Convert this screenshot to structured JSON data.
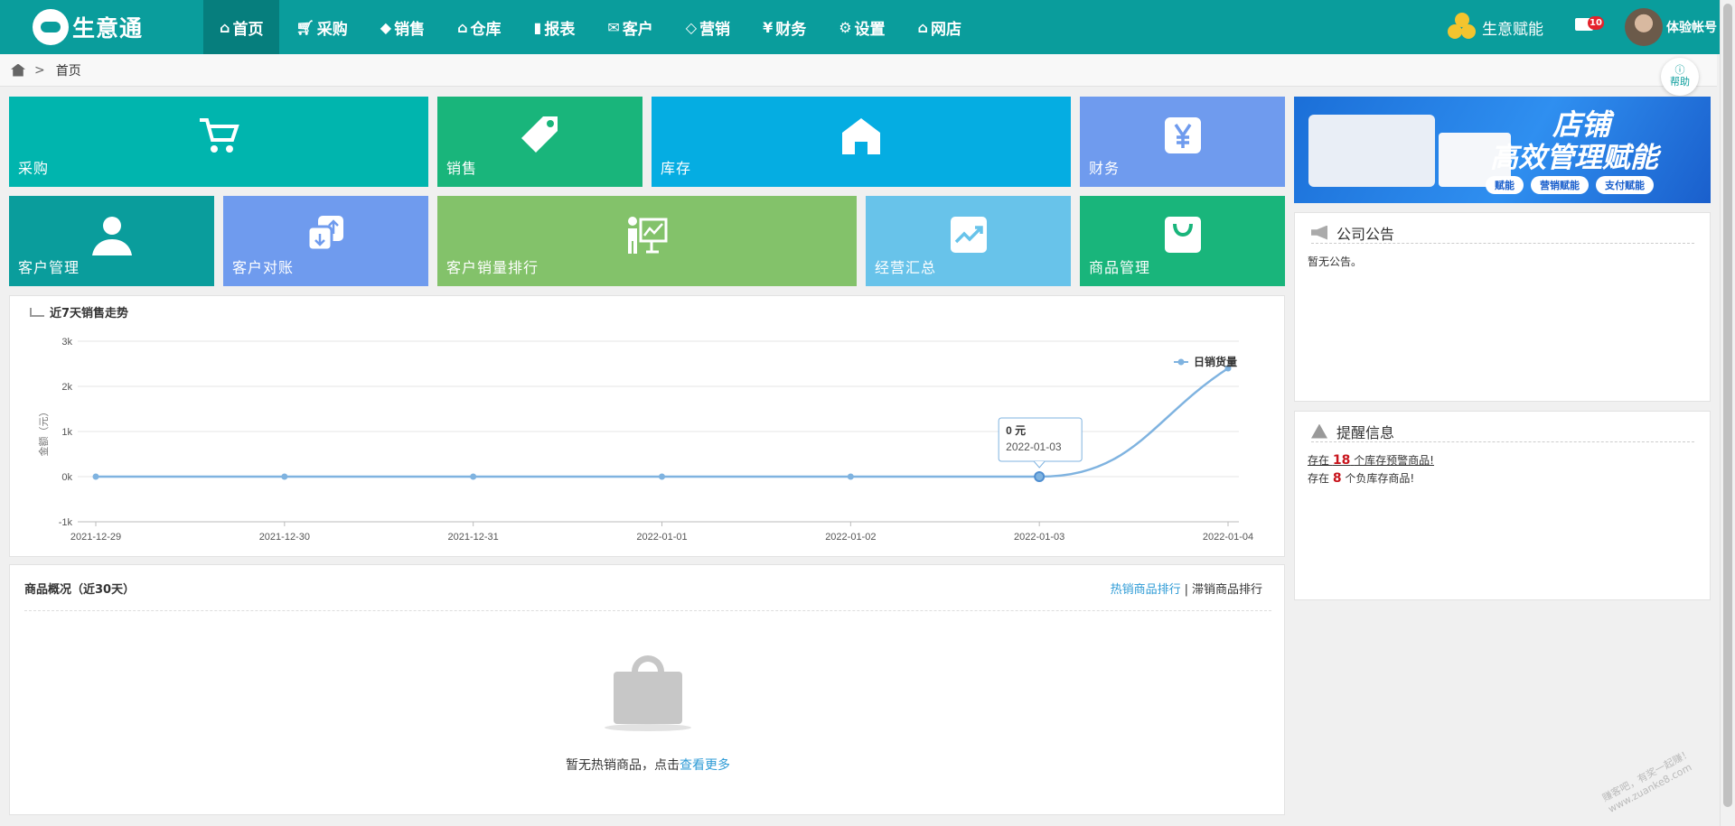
{
  "app": {
    "name": "生意通"
  },
  "nav": [
    {
      "label": "首页",
      "icon": "home-icon",
      "active": true
    },
    {
      "label": "采购",
      "icon": "cart-icon"
    },
    {
      "label": "销售",
      "icon": "tag-icon"
    },
    {
      "label": "仓库",
      "icon": "warehouse-icon"
    },
    {
      "label": "报表",
      "icon": "clipboard-icon"
    },
    {
      "label": "客户",
      "icon": "mail-icon"
    },
    {
      "label": "营销",
      "icon": "tags-icon"
    },
    {
      "label": "财务",
      "icon": "yen-icon"
    },
    {
      "label": "设置",
      "icon": "gear-icon"
    },
    {
      "label": "网店",
      "icon": "shop-icon"
    }
  ],
  "topright": {
    "energy_label": "生意赋能",
    "mail_badge": "10",
    "account": "体验帐号"
  },
  "breadcrumb": {
    "separator": ">",
    "current": "首页"
  },
  "help_label": "帮助",
  "tiles": {
    "purchase": "采购",
    "sales": "销售",
    "stock": "库存",
    "finance": "财务",
    "customer": "客户管理",
    "reconcile": "客户对账",
    "rank": "客户销量排行",
    "summary": "经营汇总",
    "goods": "商品管理"
  },
  "banner": {
    "line1": "店铺",
    "line2": "高效管理赋能",
    "pills": [
      "赋能",
      "营销赋能",
      "支付赋能"
    ]
  },
  "notice": {
    "title": "公司公告",
    "text": "暂无公告。"
  },
  "reminder": {
    "title": "提醒信息",
    "line1_pre": "存在",
    "line1_num": "18",
    "line1_post": "个库存预警商品!",
    "line2_pre": "存在",
    "line2_num": "8",
    "line2_post": "个负库存商品!"
  },
  "chart_title": "近7天销售走势",
  "chart_data": {
    "type": "line",
    "title": "近7天销售走势",
    "ylabel": "金额（元）",
    "x": [
      "2021-12-29",
      "2021-12-30",
      "2021-12-31",
      "2022-01-01",
      "2022-01-02",
      "2022-01-03",
      "2022-01-04"
    ],
    "series": [
      {
        "name": "日销货量",
        "values": [
          0,
          0,
          0,
          0,
          0,
          0,
          2400
        ]
      }
    ],
    "yticks": [
      "3k",
      "2k",
      "1k",
      "0k",
      "-1k"
    ],
    "ylim": [
      -1000,
      3000
    ],
    "grid": true,
    "legend": "top-right",
    "color": "#7fb3e0",
    "tooltip": {
      "value": "0 元",
      "date": "2022-01-03",
      "index": 5
    }
  },
  "goods": {
    "title": "商品概况（近30天）",
    "hot_link": "热销商品排行",
    "separator": "|",
    "slow_link": "滞销商品排行",
    "empty_text": "暂无热销商品，点击",
    "more_link": "查看更多"
  },
  "watermark": "赚客吧，有奖一起赚！www.zuanke8.com",
  "colors": {
    "primary": "#0a9d9c",
    "accent_red": "#c8151d",
    "link": "#2e9bd6"
  }
}
